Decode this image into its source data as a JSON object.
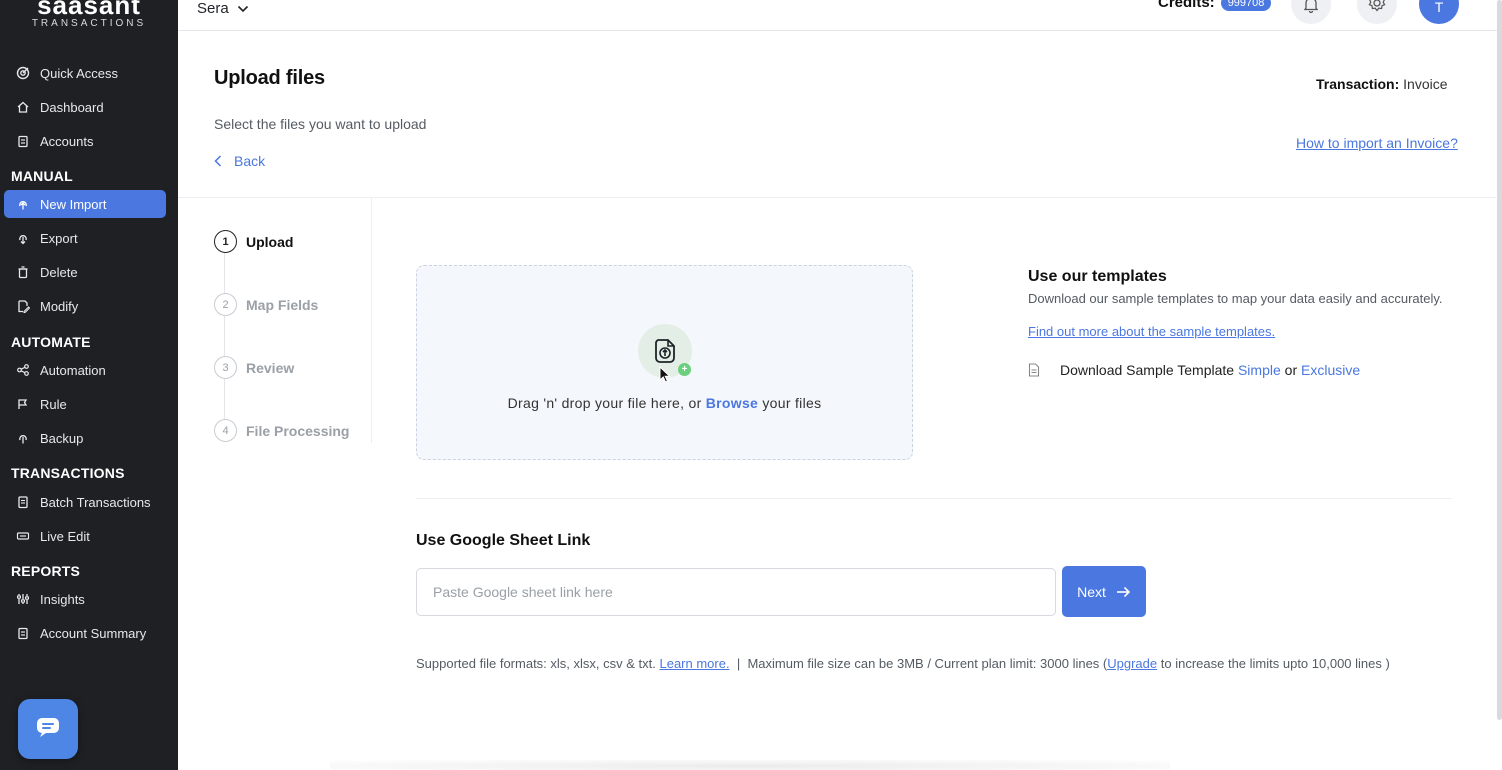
{
  "brand": {
    "name": "saasant",
    "sub": "TRANSACTIONS"
  },
  "sidebar": {
    "top_items": [
      {
        "label": "Quick Access",
        "icon": "quick-access-icon"
      },
      {
        "label": "Dashboard",
        "icon": "home-icon"
      },
      {
        "label": "Accounts",
        "icon": "clipboard-icon"
      }
    ],
    "sections": {
      "manual": "MANUAL",
      "automate": "AUTOMATE",
      "transactions": "TRANSACTIONS",
      "reports": "REPORTS"
    },
    "manual_items": [
      {
        "label": "New Import",
        "active": true
      },
      {
        "label": "Export"
      },
      {
        "label": "Delete"
      },
      {
        "label": "Modify"
      }
    ],
    "automate_items": [
      {
        "label": "Automation"
      },
      {
        "label": "Rule"
      },
      {
        "label": "Backup"
      }
    ],
    "transactions_items": [
      {
        "label": "Batch Transactions"
      },
      {
        "label": "Live Edit"
      }
    ],
    "reports_items": [
      {
        "label": "Insights"
      },
      {
        "label": "Account Summary"
      }
    ]
  },
  "topbar": {
    "workspace": "Sera",
    "credits_label": "Credits:",
    "credits_value": "999708",
    "avatar_initial": "T"
  },
  "header": {
    "title": "Upload files",
    "subtitle": "Select the files you want to upload",
    "back": "Back",
    "transaction_label": "Transaction:",
    "transaction_value": "Invoice",
    "howto_link": "How to import an Invoice?"
  },
  "steps": [
    {
      "num": "1",
      "label": "Upload"
    },
    {
      "num": "2",
      "label": "Map Fields"
    },
    {
      "num": "3",
      "label": "Review"
    },
    {
      "num": "4",
      "label": "File Processing"
    }
  ],
  "dropzone": {
    "text_before": "Drag 'n' drop your file here, or",
    "browse": "Browse",
    "text_after": "your files",
    "plus": "+"
  },
  "templates": {
    "title": "Use our templates",
    "desc": "Download our sample templates to map your data easily and accurately.",
    "link": "Find out more about the sample templates.",
    "download_prefix": "Download Sample Template",
    "simple": "Simple",
    "or": "or",
    "exclusive": "Exclusive"
  },
  "google_sheet": {
    "title": "Use Google Sheet Link",
    "placeholder": "Paste Google sheet link here",
    "next": "Next"
  },
  "footnote": {
    "formats": "Supported file formats: xls, xlsx, csv & txt.",
    "learn_more": "Learn more.",
    "sep": "|",
    "limit": "Maximum file size can be 3MB / Current plan limit: 3000 lines (",
    "upgrade": "Upgrade",
    "limit_after": "to increase the limits upto 10,000 lines )"
  },
  "colors": {
    "accent": "#4a77e0",
    "sidebar_bg": "#1e2024"
  }
}
